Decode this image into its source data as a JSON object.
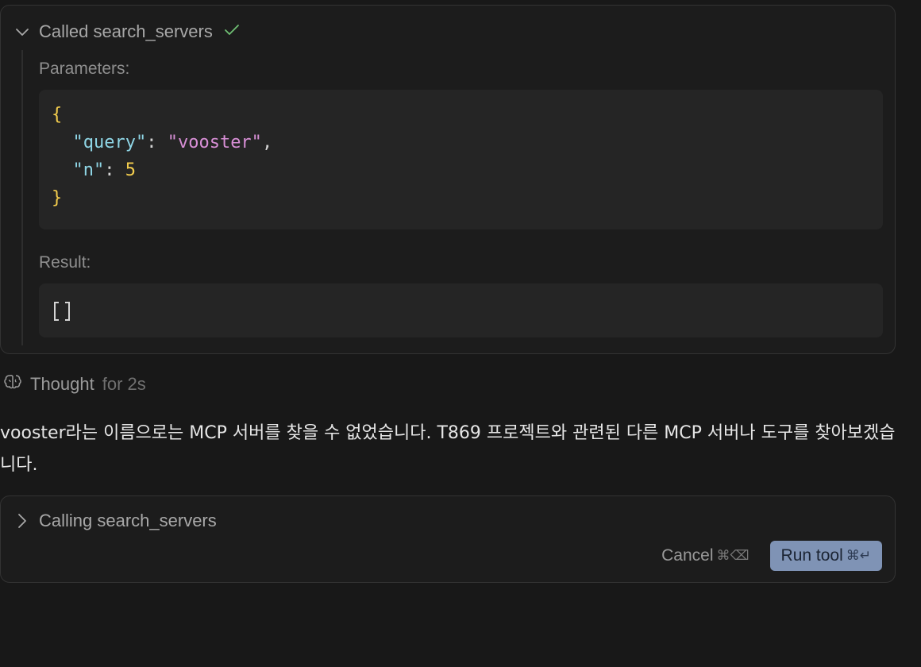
{
  "tool_call_1": {
    "status_label": "Called search_servers",
    "params_label": "Parameters:",
    "params": {
      "open": "{",
      "close": "}",
      "entries": [
        {
          "key": "\"query\"",
          "value": "\"vooster\"",
          "trailing": ","
        },
        {
          "key": "\"n\"",
          "value": "5",
          "trailing": ""
        }
      ]
    },
    "result_label": "Result:",
    "result_value": "[]"
  },
  "thought": {
    "label": "Thought",
    "duration": "for 2s"
  },
  "message": {
    "text": "vooster라는 이름으로는 MCP 서버를 찾을 수 없었습니다. T869 프로젝트와 관련된 다른 MCP 서버나 도구를 찾아보겠습니다."
  },
  "tool_call_2": {
    "status_label": "Calling search_servers",
    "cancel_label": "Cancel",
    "cancel_shortcut": "⌘⌫",
    "run_label": "Run tool",
    "run_shortcut": "⌘↵"
  },
  "colors": {
    "background": "#181818",
    "run_button": "#7f93b5",
    "check": "#6fbf73",
    "json_key": "#8fd6e6",
    "json_string": "#d88fd6",
    "json_brace": "#f2cc4d"
  }
}
